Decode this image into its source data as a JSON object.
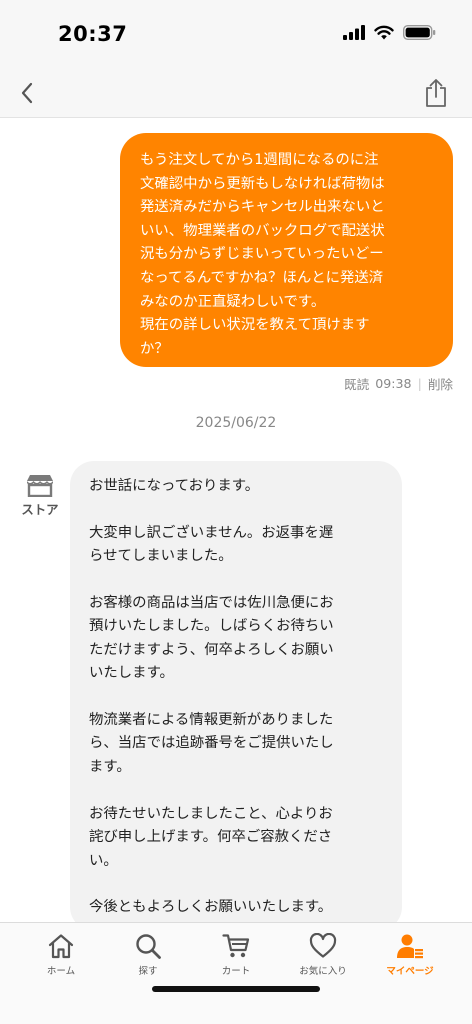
{
  "status_bar": {
    "time": "20:37"
  },
  "nav": {
    "back_icon": "chevron-left-icon",
    "share_icon": "share-icon"
  },
  "outgoing_message": {
    "text": "もう注文してから1週間になるのに注\n文確認中から更新もしなければ荷物は\n発送済みだからキャンセル出来ないと\nいい、物理業者のバックログで配送状\n況も分からずじまいっていったいどー\nなってるんですかね？ほんとに発送済\nみなのか正直疑わしいです。\n現在の詳しい状況を教えて頂けます\nか？",
    "read_label": "既読",
    "time": "09:38",
    "delete_label": "削除",
    "color": "#ff8400"
  },
  "date_separator": "2025/06/22",
  "store": {
    "label": "ストア",
    "icon": "store-icon"
  },
  "incoming_message": {
    "text": "お世話になっております。\n\n大変申し訳ございません。お返事を遅\nらせてしまいました。\n\nお客様の商品は当店では佐川急便にお\n預けいたしました。しばらくお待ちい\nただけますよう、何卒よろしくお願い\nいたします。\n\n物流業者による情報更新がありました\nら、当店では追跡番号をご提供いたし\nます。\n\nお待たせいたしましたこと、心よりお\n詫び申し上げます。何卒ご容赦くださ\nい。\n\n今後ともよろしくお願いいたします。"
  },
  "tabs": [
    {
      "label": "ホーム",
      "icon": "home-icon",
      "active": false
    },
    {
      "label": "探す",
      "icon": "search-icon",
      "active": false
    },
    {
      "label": "カート",
      "icon": "cart-icon",
      "active": false
    },
    {
      "label": "お気に入り",
      "icon": "heart-icon",
      "active": false
    },
    {
      "label": "マイページ",
      "icon": "mypage-icon",
      "active": true
    }
  ],
  "colors": {
    "accent": "#ff7d00",
    "bubble_out": "#ff8400",
    "bubble_in": "#f2f2f2"
  }
}
